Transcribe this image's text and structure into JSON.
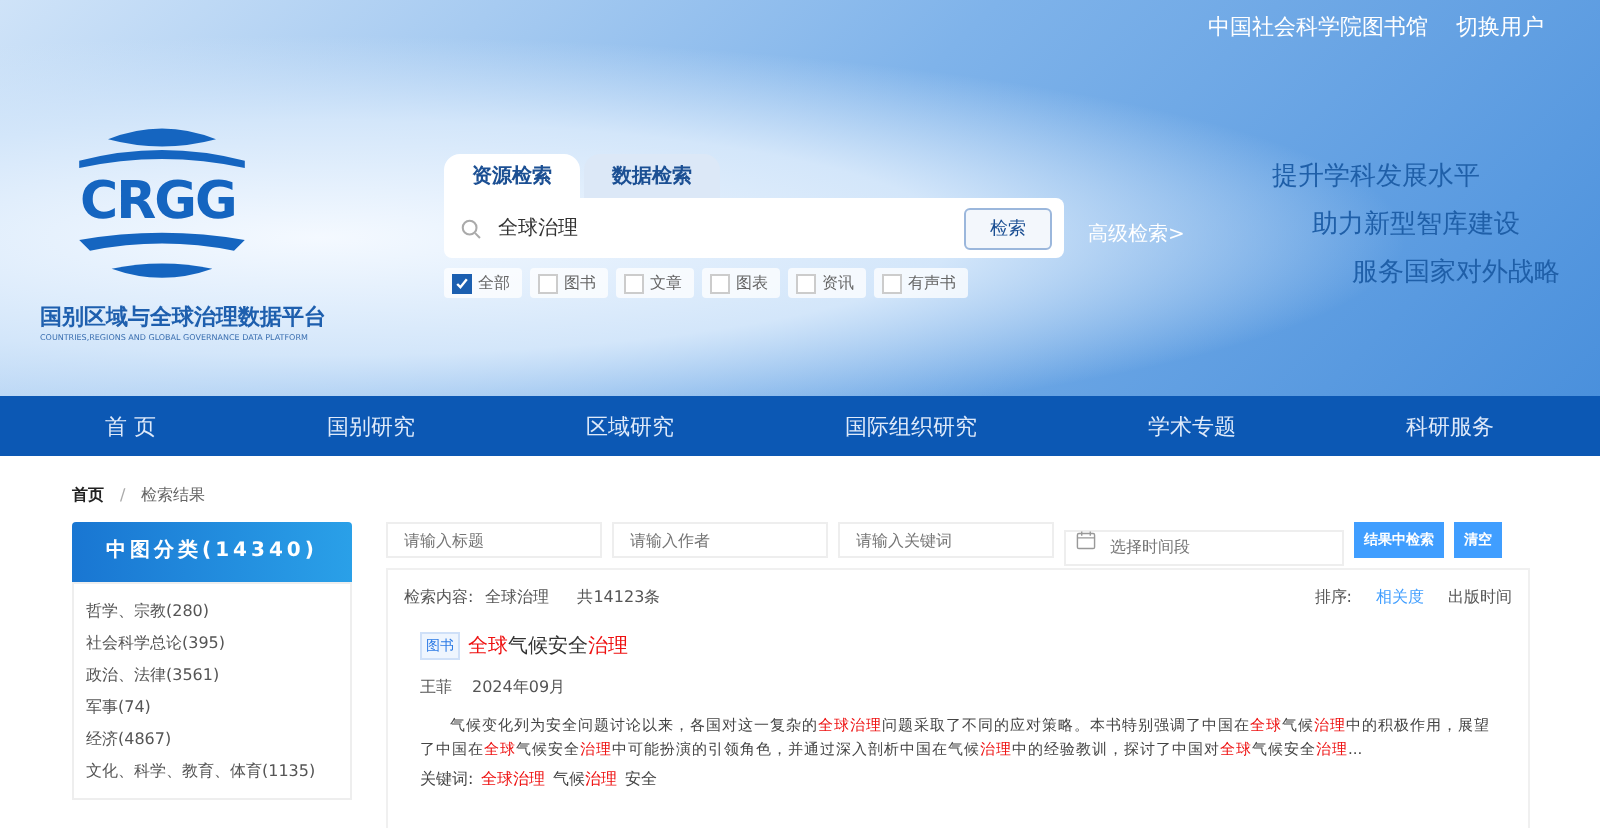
{
  "top_links": [
    "中国社会科学院图书馆",
    "切换用户"
  ],
  "logo": {
    "mark": "CRGG",
    "title": "国别区域与全球治理数据平台",
    "subtitle": "COUNTRIES,REGIONS AND GLOBAL GOVERNANCE DATA PLATFORM"
  },
  "search": {
    "tabs": [
      {
        "label": "资源检索",
        "selected": true
      },
      {
        "label": "数据检索",
        "selected": false
      }
    ],
    "value": "全球治理",
    "button": "检索",
    "advanced": "高级检索>",
    "filters": [
      {
        "label": "全部",
        "checked": true
      },
      {
        "label": "图书",
        "checked": false
      },
      {
        "label": "文章",
        "checked": false
      },
      {
        "label": "图表",
        "checked": false
      },
      {
        "label": "资讯",
        "checked": false
      },
      {
        "label": "有声书",
        "checked": false
      }
    ]
  },
  "taglines": [
    "提升学科发展水平",
    "助力新型智库建设",
    "服务国家对外战略"
  ],
  "nav": [
    {
      "label": "首 页",
      "selected": false
    },
    {
      "label": "国别研究",
      "selected": false
    },
    {
      "label": "区域研究",
      "selected": false
    },
    {
      "label": "国际组织研究",
      "selected": false
    },
    {
      "label": "学术专题",
      "selected": false
    },
    {
      "label": "科研服务",
      "selected": false
    }
  ],
  "breadcrumb": {
    "items": [
      "首页",
      "检索结果"
    ],
    "separator": "/"
  },
  "sidebar": {
    "title": "中图分类(14340)",
    "items": [
      "哲学、宗教(280)",
      "社会科学总论(395)",
      "政治、法律(3561)",
      "军事(74)",
      "经济(4867)",
      "文化、科学、教育、体育(1135)"
    ]
  },
  "filters_row": {
    "title_placeholder": "请输入标题",
    "author_placeholder": "请输入作者",
    "keyword_placeholder": "请输入关键词",
    "date_placeholder": "选择时间段",
    "search_button": "结果中检索",
    "clear_button": "清空"
  },
  "summary": {
    "label": "检索内容:",
    "query": "全球治理",
    "count": "共14123条",
    "sort_label": "排序:",
    "sort_options": [
      {
        "label": "相关度",
        "selected": true
      },
      {
        "label": "出版时间",
        "selected": false
      }
    ]
  },
  "results": [
    {
      "type": "图书",
      "title": [
        {
          "text": "全球",
          "highlight": true
        },
        {
          "text": "气候安全",
          "highlight": false
        },
        {
          "text": "治理",
          "highlight": true
        }
      ],
      "author": "王菲",
      "date": "2024年09月",
      "abstract": [
        {
          "text": "气候变化列为安全问题讨论以来，各国对这一复杂的",
          "highlight": false
        },
        {
          "text": "全球治理",
          "highlight": true
        },
        {
          "text": "问题采取了不同的应对策略。本书特别强调了中国在",
          "highlight": false
        },
        {
          "text": "全球",
          "highlight": true
        },
        {
          "text": "气候",
          "highlight": false
        },
        {
          "text": "治理",
          "highlight": true
        },
        {
          "text": "中的积极作用，展望了中国在",
          "highlight": false
        },
        {
          "text": "全球",
          "highlight": true
        },
        {
          "text": "气候安全",
          "highlight": false
        },
        {
          "text": "治理",
          "highlight": true
        },
        {
          "text": "中可能扮演的引领角色，并通过深入剖析中国在气候",
          "highlight": false
        },
        {
          "text": "治理",
          "highlight": true
        },
        {
          "text": "中的经验教训，探讨了中国对",
          "highlight": false
        },
        {
          "text": "全球",
          "highlight": true
        },
        {
          "text": "气候安全",
          "highlight": false
        },
        {
          "text": "治理",
          "highlight": true
        },
        {
          "text": "...",
          "highlight": false
        }
      ],
      "keywords_label": "关键词:",
      "keywords": [
        [
          {
            "text": "全球治理",
            "highlight": true
          }
        ],
        [
          {
            "text": "气候",
            "highlight": false
          },
          {
            "text": "治理",
            "highlight": true
          }
        ],
        [
          {
            "text": "安全",
            "highlight": false
          }
        ]
      ]
    }
  ]
}
